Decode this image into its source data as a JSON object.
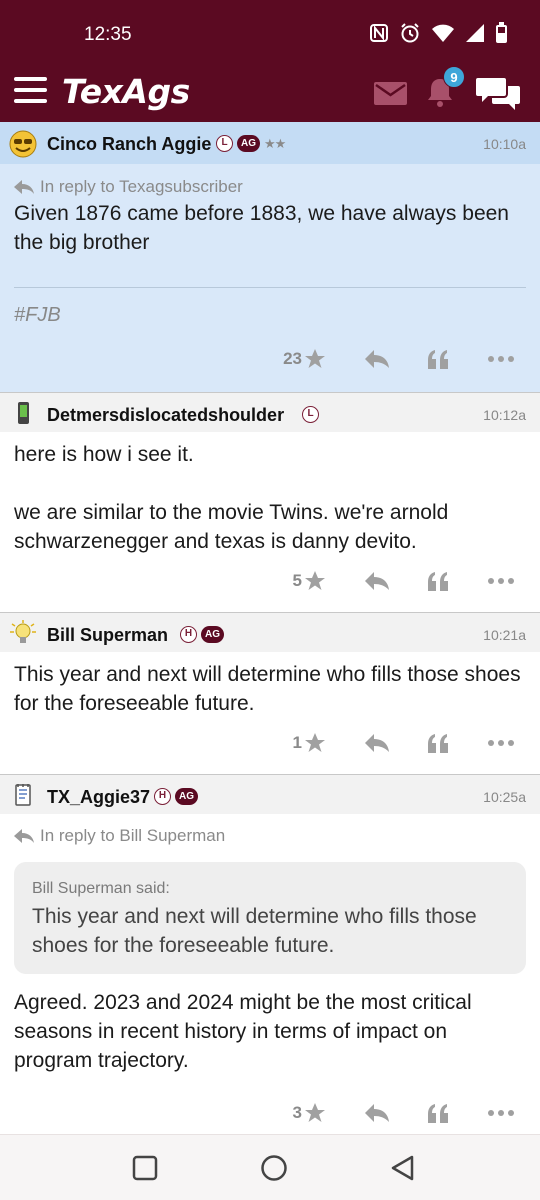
{
  "status": {
    "time": "12:35"
  },
  "app": {
    "logo": "TexAgs",
    "notification_count": "9"
  },
  "posts": [
    {
      "username": "Cinco Ranch Aggie",
      "badge_letter": "L",
      "badge_ag": "AG",
      "stars": "★★",
      "time": "10:10a",
      "reply_to": "In reply to Texagsubscriber",
      "text": "Given 1876 came before 1883, we have always been the big brother",
      "signature": "#FJB",
      "likes": "23"
    },
    {
      "username": "Detmersdislocatedshoulder",
      "badge_letter": "L",
      "time": "10:12a",
      "text_line1": "here is how i see it.",
      "text_line2": "we are similar to the movie Twins. we're arnold schwarzenegger and texas is danny devito.",
      "likes": "5"
    },
    {
      "username": "Bill Superman",
      "badge_letter": "H",
      "badge_ag": "AG",
      "time": "10:21a",
      "text": "This year and next will determine who fills those shoes for the foreseeable future.",
      "likes": "1"
    },
    {
      "username": "TX_Aggie37",
      "badge_letter": "H",
      "badge_ag": "AG",
      "time": "10:25a",
      "reply_to": "In reply to Bill Superman",
      "quote_author": "Bill Superman said:",
      "quote_text": "This year and next will determine who fills those shoes for the foreseeable future.",
      "text": "Agreed. 2023 and 2024 might be the most critical seasons in recent history in terms of impact on program trajectory.",
      "likes": "3"
    }
  ],
  "colors": {
    "brand": "#5b0a22",
    "highlight": "#d9e8f9",
    "badge": "#3ea6d9"
  }
}
